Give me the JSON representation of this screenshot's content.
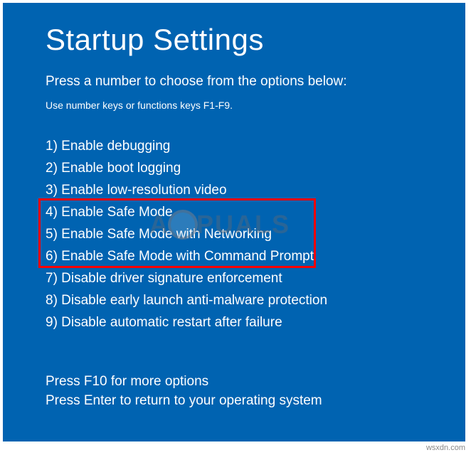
{
  "title": "Startup Settings",
  "subtitle": "Press a number to choose from the options below:",
  "hint": "Use number keys or functions keys F1-F9.",
  "options": [
    "1) Enable debugging",
    "2) Enable boot logging",
    "3) Enable low-resolution video",
    "4) Enable Safe Mode",
    "5) Enable Safe Mode with Networking",
    "6) Enable Safe Mode with Command Prompt",
    "7) Disable driver signature enforcement",
    "8) Disable early launch anti-malware protection",
    "9) Disable automatic restart after failure"
  ],
  "footer": {
    "more": "Press F10 for more options",
    "return": "Press Enter to return to your operating system"
  },
  "watermark": {
    "prefix": "A",
    "suffix": "PUALS"
  },
  "attribution": "wsxdn.com"
}
